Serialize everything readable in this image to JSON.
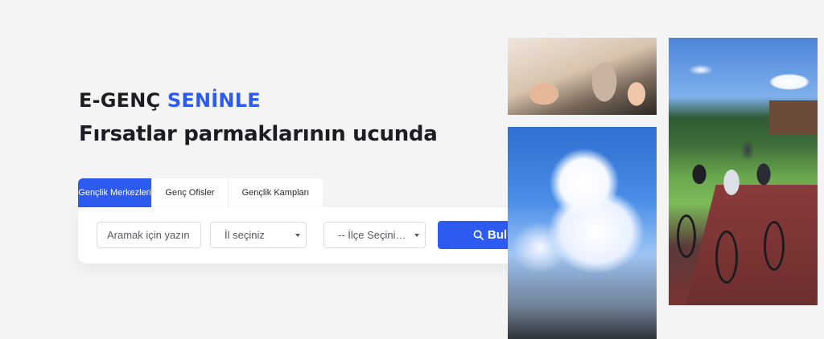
{
  "hero": {
    "title_part1": "E-GENÇ",
    "title_part2": "SENİNLE",
    "subtitle": "Fırsatlar parmaklarının ucunda"
  },
  "tabs": [
    {
      "label": "Gençlik Merkezleri",
      "active": true
    },
    {
      "label": "Genç Ofisler",
      "active": false
    },
    {
      "label": "Gençlik Kampları",
      "active": false
    }
  ],
  "search": {
    "placeholder": "Aramak için yazın",
    "province_select": "İl seçiniz",
    "district_select": "-- İlçe Seçiniz --",
    "button_label": "Bul",
    "button_icon": "search-icon"
  },
  "colors": {
    "accent": "#2d5bf0",
    "text": "#1c1d22",
    "background": "#f4f4f5"
  }
}
